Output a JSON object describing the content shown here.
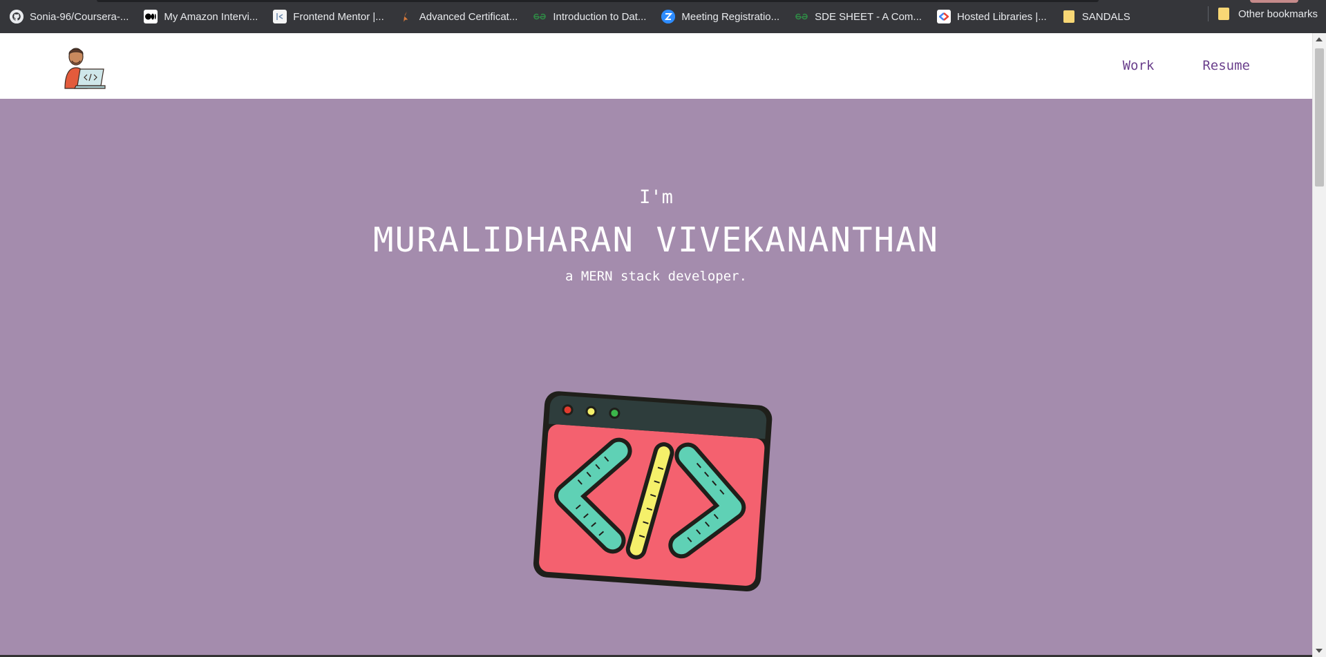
{
  "bookmarks": [
    {
      "label": "Sonia-96/Coursera-...",
      "icon": "github-icon"
    },
    {
      "label": "My Amazon Intervi...",
      "icon": "medium-icon"
    },
    {
      "label": "Frontend Mentor |...",
      "icon": "frontend-mentor-icon"
    },
    {
      "label": "Advanced Certificat...",
      "icon": "upgrad-icon"
    },
    {
      "label": "Introduction to Dat...",
      "icon": "geeksforgeeks-icon"
    },
    {
      "label": "Meeting Registratio...",
      "icon": "zoom-icon"
    },
    {
      "label": "SDE SHEET - A Com...",
      "icon": "geeksforgeeks-icon"
    },
    {
      "label": "Hosted Libraries |...",
      "icon": "google-icon"
    },
    {
      "label": "SANDALS",
      "icon": "folder-icon"
    }
  ],
  "other_bookmarks": "Other bookmarks",
  "nav": {
    "work": "Work",
    "resume": "Resume"
  },
  "hero": {
    "intro": "I'm",
    "name": "MURALIDHARAN VIVEKANANTHAN",
    "role": "a MERN stack developer."
  },
  "colors": {
    "hero_bg": "#a48cad",
    "nav_link": "#6a3f8c",
    "browser_bar": "#35363a",
    "window_body": "#f4616f",
    "code_bracket": "#5fd1b5",
    "code_slash": "#f5f06a"
  }
}
